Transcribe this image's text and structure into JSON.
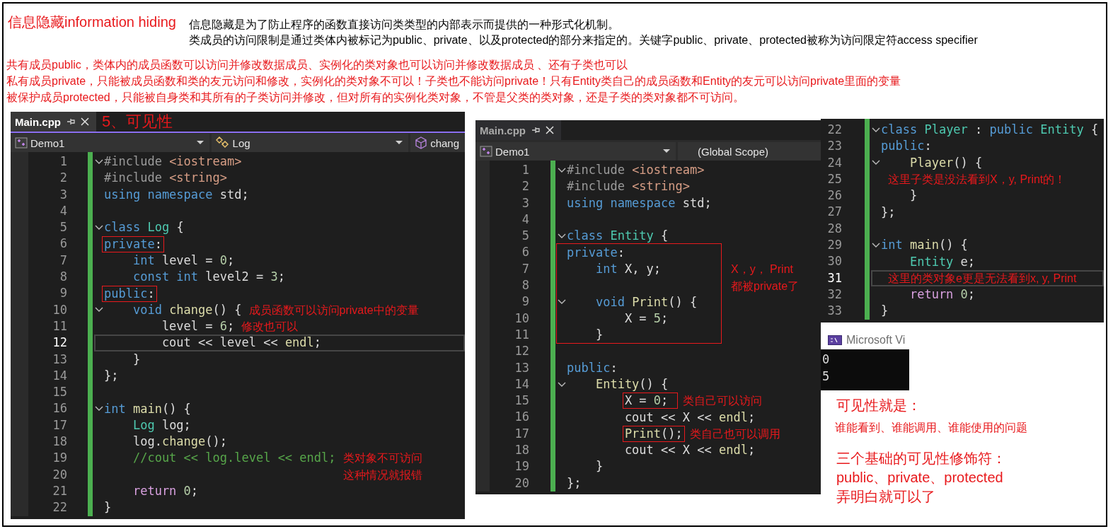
{
  "heading": {
    "title": "信息隐藏information hiding",
    "description": [
      "信息隐藏是为了防止程序的函数直接访问类类型的内部表示而提供的一种形式化机制。",
      "类成员的访问限制是通过类体内被标记为public、private、以及protected的部分来指定的。关键字public、private、protected被称为访问限定符access specifier"
    ]
  },
  "notes": [
    "共有成员public，类体内的成员函数可以访问并修改数据成员、实例化的类对象也可以访问并修改数据成员 、还有子类也可以",
    "私有成员private，只能被成员函数和类的友元访问和修改，实例化的类对象不可以！子类也不能访问private！只有Entity类自己的成员函数和Entity的友元可以访问private里面的变量",
    "被保护成员protected，只能被自身类和其所有的子类访问并修改，但对所有的实例化类对象，不管是父类的类对象，还是子类的类对象都不可访问。"
  ],
  "editors": [
    {
      "tab": {
        "label": "Main.cpp",
        "selected": true
      },
      "caption": "5、可见性",
      "nav": [
        {
          "kind": "project",
          "label": "Demo1",
          "caret": true
        },
        {
          "kind": "class",
          "label": "Log",
          "caret": true
        },
        {
          "kind": "method",
          "label": "chang",
          "caret": false
        }
      ],
      "lines": [
        {
          "kind": "line",
          "number": "1",
          "fold": true,
          "tokens": [
            {
              "kind": "pp",
              "text": "#include "
            },
            {
              "kind": "str",
              "text": "<iostream>"
            }
          ]
        },
        {
          "kind": "line",
          "number": "2",
          "tokens": [
            {
              "kind": "pp",
              "text": "#include "
            },
            {
              "kind": "str",
              "text": "<string>"
            }
          ]
        },
        {
          "kind": "line",
          "number": "3",
          "tokens": [
            {
              "kind": "kw",
              "text": "using namespace"
            },
            {
              "kind": "p",
              "text": " std;"
            }
          ]
        },
        {
          "kind": "line",
          "number": "4"
        },
        {
          "kind": "line",
          "number": "5",
          "fold": true,
          "tokens": [
            {
              "kind": "kw",
              "text": "class "
            },
            {
              "kind": "type",
              "text": "Log"
            },
            {
              "kind": "p",
              "text": " {"
            }
          ]
        },
        {
          "kind": "line",
          "number": "6",
          "tokens": [
            {
              "kind": "kw",
              "text": "private",
              "boxed": true
            },
            {
              "kind": "p",
              "text": ":",
              "boxed": true
            }
          ]
        },
        {
          "kind": "line",
          "number": "7",
          "tokens": [
            {
              "kind": "kw",
              "text": "    int"
            },
            {
              "kind": "p",
              "text": " level = "
            },
            {
              "kind": "num",
              "text": "0"
            },
            {
              "kind": "p",
              "text": ";"
            }
          ]
        },
        {
          "kind": "line",
          "number": "8",
          "tokens": [
            {
              "kind": "kw",
              "text": "    const int"
            },
            {
              "kind": "p",
              "text": " level2 = "
            },
            {
              "kind": "num",
              "text": "3"
            },
            {
              "kind": "p",
              "text": ";"
            }
          ]
        },
        {
          "kind": "line",
          "number": "9",
          "tokens": [
            {
              "kind": "kw",
              "text": "public",
              "boxed": true
            },
            {
              "kind": "p",
              "text": ":",
              "boxed": true
            }
          ]
        },
        {
          "kind": "line",
          "number": "10",
          "fold": true,
          "tokens": [
            {
              "kind": "kw",
              "text": "    void "
            },
            {
              "kind": "fn",
              "text": "change"
            },
            {
              "kind": "p",
              "text": "() {"
            }
          ],
          "note": [
            "成员函数可以访问private中的变量"
          ]
        },
        {
          "kind": "line",
          "number": "11",
          "tokens": [
            {
              "kind": "p",
              "text": "        level = "
            },
            {
              "kind": "num",
              "text": "6"
            },
            {
              "kind": "p",
              "text": ";"
            }
          ],
          "note": [
            "修改也可以"
          ]
        },
        {
          "kind": "line",
          "number": "12",
          "current": true,
          "tokens": [
            {
              "kind": "p",
              "text": "        cout << level << "
            },
            {
              "kind": "fn",
              "text": "endl"
            },
            {
              "kind": "p",
              "text": ";"
            }
          ]
        },
        {
          "kind": "line",
          "number": "13",
          "tokens": [
            {
              "kind": "p",
              "text": "    }"
            }
          ]
        },
        {
          "kind": "line",
          "number": "14",
          "tokens": [
            {
              "kind": "p",
              "text": "};"
            }
          ]
        },
        {
          "kind": "line",
          "number": "15"
        },
        {
          "kind": "line",
          "number": "16",
          "fold": true,
          "tokens": [
            {
              "kind": "kw",
              "text": "int "
            },
            {
              "kind": "fn",
              "text": "main"
            },
            {
              "kind": "p",
              "text": "() {"
            }
          ]
        },
        {
          "kind": "line",
          "number": "17",
          "tokens": [
            {
              "kind": "type",
              "text": "    Log"
            },
            {
              "kind": "p",
              "text": " log;"
            }
          ]
        },
        {
          "kind": "line",
          "number": "18",
          "tokens": [
            {
              "kind": "p",
              "text": "    log."
            },
            {
              "kind": "fn",
              "text": "change"
            },
            {
              "kind": "p",
              "text": "();"
            }
          ]
        },
        {
          "kind": "line",
          "number": "19",
          "tokens": [
            {
              "kind": "cmt",
              "text": "    //cout << log.level << endl;"
            }
          ],
          "note": [
            "类对象不可访问",
            "这种情况就报错"
          ]
        },
        {
          "kind": "line",
          "number": "20"
        },
        {
          "kind": "line",
          "number": "21",
          "tokens": [
            {
              "kind": "ctl",
              "text": "    return "
            },
            {
              "kind": "num",
              "text": "0"
            },
            {
              "kind": "p",
              "text": ";"
            }
          ]
        },
        {
          "kind": "line",
          "number": "22",
          "tokens": [
            {
              "kind": "p",
              "text": "}"
            }
          ]
        }
      ]
    },
    {
      "tab": {
        "label": "Main.cpp",
        "selected": false
      },
      "nav": [
        {
          "kind": "project",
          "label": "Demo1",
          "caret": true
        },
        {
          "kind": "scope",
          "label": "(Global Scope)",
          "caret": false
        }
      ],
      "lines": [
        {
          "kind": "line",
          "number": "1",
          "fold": true,
          "tokens": [
            {
              "kind": "pp",
              "text": "#include "
            },
            {
              "kind": "str",
              "text": "<iostream>"
            }
          ]
        },
        {
          "kind": "line",
          "number": "2",
          "tokens": [
            {
              "kind": "pp",
              "text": "#include "
            },
            {
              "kind": "str",
              "text": "<string>"
            }
          ]
        },
        {
          "kind": "line",
          "number": "3",
          "tokens": [
            {
              "kind": "kw",
              "text": "using namespace"
            },
            {
              "kind": "p",
              "text": " std;"
            }
          ]
        },
        {
          "kind": "line",
          "number": "4"
        },
        {
          "kind": "line",
          "number": "5",
          "fold": true,
          "tokens": [
            {
              "kind": "kw",
              "text": "class "
            },
            {
              "kind": "type",
              "text": "Entity"
            },
            {
              "kind": "p",
              "text": " {"
            }
          ]
        },
        {
          "kind": "annotation_box",
          "lines": [
            {
              "kind": "line",
              "number": "6",
              "tokens": [
                {
                  "kind": "kw",
                  "text": "private"
                },
                {
                  "kind": "p",
                  "text": ":"
                }
              ]
            },
            {
              "kind": "line",
              "number": "7",
              "tokens": [
                {
                  "kind": "kw",
                  "text": "    int"
                },
                {
                  "kind": "p",
                  "text": " X, y;"
                }
              ],
              "note": [
                "X，y， Print",
                "都被private了"
              ]
            },
            {
              "kind": "line",
              "number": "8"
            },
            {
              "kind": "line",
              "number": "9",
              "fold": true,
              "tokens": [
                {
                  "kind": "kw",
                  "text": "    void "
                },
                {
                  "kind": "fn",
                  "text": "Print"
                },
                {
                  "kind": "p",
                  "text": "() {"
                }
              ]
            },
            {
              "kind": "line",
              "number": "10",
              "tokens": [
                {
                  "kind": "p",
                  "text": "        X = "
                },
                {
                  "kind": "num",
                  "text": "5"
                },
                {
                  "kind": "p",
                  "text": ";"
                }
              ]
            },
            {
              "kind": "line",
              "number": "11",
              "tokens": [
                {
                  "kind": "p",
                  "text": "    }"
                }
              ]
            }
          ]
        },
        {
          "kind": "line",
          "number": "12"
        },
        {
          "kind": "line",
          "number": "13",
          "tokens": [
            {
              "kind": "kw",
              "text": "public"
            },
            {
              "kind": "p",
              "text": ":"
            }
          ]
        },
        {
          "kind": "line",
          "number": "14",
          "fold": true,
          "tokens": [
            {
              "kind": "fn",
              "text": "    Entity"
            },
            {
              "kind": "p",
              "text": "() {"
            }
          ]
        },
        {
          "kind": "line",
          "number": "15",
          "tokens": [
            {
              "kind": "p",
              "text": "X = ",
              "boxed": true
            },
            {
              "kind": "num",
              "text": "0",
              "boxed": true
            },
            {
              "kind": "p",
              "text": "; ",
              "boxed": true
            }
          ],
          "indented": true,
          "note": [
            "类自己可以访问"
          ]
        },
        {
          "kind": "line",
          "number": "16",
          "tokens": [
            {
              "kind": "p",
              "text": "        cout << X << "
            },
            {
              "kind": "fn",
              "text": "endl"
            },
            {
              "kind": "p",
              "text": ";"
            }
          ]
        },
        {
          "kind": "line",
          "number": "17",
          "tokens": [
            {
              "kind": "fn",
              "text": "Print",
              "boxed": true
            },
            {
              "kind": "p",
              "text": "();",
              "boxed": true
            }
          ],
          "indented": true,
          "note": [
            "类自己也可以调用"
          ]
        },
        {
          "kind": "line",
          "number": "18",
          "tokens": [
            {
              "kind": "p",
              "text": "        cout << X << "
            },
            {
              "kind": "fn",
              "text": "endl"
            },
            {
              "kind": "p",
              "text": ";"
            }
          ]
        },
        {
          "kind": "line",
          "number": "19",
          "tokens": [
            {
              "kind": "p",
              "text": "    }"
            }
          ]
        },
        {
          "kind": "line",
          "number": "20",
          "tokens": [
            {
              "kind": "p",
              "text": "};"
            }
          ]
        }
      ]
    },
    {
      "lines": [
        {
          "kind": "line",
          "number": "22",
          "fold": true,
          "tokens": [
            {
              "kind": "kw",
              "text": "class "
            },
            {
              "kind": "type",
              "text": "Player"
            },
            {
              "kind": "p",
              "text": " : "
            },
            {
              "kind": "kw",
              "text": "public "
            },
            {
              "kind": "type",
              "text": "Entity"
            },
            {
              "kind": "p",
              "text": " {"
            }
          ]
        },
        {
          "kind": "line",
          "number": "23",
          "tokens": [
            {
              "kind": "kw",
              "text": "public"
            },
            {
              "kind": "p",
              "text": ":"
            }
          ]
        },
        {
          "kind": "line",
          "number": "24",
          "fold": true,
          "tokens": [
            {
              "kind": "fn",
              "text": "    Player"
            },
            {
              "kind": "p",
              "text": "() {"
            }
          ]
        },
        {
          "kind": "line",
          "number": "25",
          "note": [
            "这里子类是没法看到X，y, Print的！"
          ]
        },
        {
          "kind": "line",
          "number": "26",
          "tokens": [
            {
              "kind": "p",
              "text": "    }"
            }
          ]
        },
        {
          "kind": "line",
          "number": "27",
          "tokens": [
            {
              "kind": "p",
              "text": "};"
            }
          ]
        },
        {
          "kind": "line",
          "number": "28"
        },
        {
          "kind": "line",
          "number": "29",
          "fold": true,
          "tokens": [
            {
              "kind": "kw",
              "text": "int "
            },
            {
              "kind": "fn",
              "text": "main"
            },
            {
              "kind": "p",
              "text": "() {"
            }
          ]
        },
        {
          "kind": "line",
          "number": "30",
          "tokens": [
            {
              "kind": "type",
              "text": "    Entity"
            },
            {
              "kind": "p",
              "text": " e;"
            }
          ]
        },
        {
          "kind": "line",
          "number": "31",
          "current": true,
          "note": [
            "这里的类对象e更是无法看到x, y, Print"
          ]
        },
        {
          "kind": "line",
          "number": "32",
          "tokens": [
            {
              "kind": "ctl",
              "text": "    return "
            },
            {
              "kind": "num",
              "text": "0"
            },
            {
              "kind": "p",
              "text": ";"
            }
          ]
        },
        {
          "kind": "line",
          "number": "33",
          "tokens": [
            {
              "kind": "p",
              "text": "}"
            }
          ]
        }
      ]
    }
  ],
  "console": {
    "title": "Microsoft Vi",
    "output": [
      "0",
      "5"
    ]
  },
  "summary": [
    {
      "kind": "heading",
      "text": "可见性就是："
    },
    {
      "kind": "body",
      "text": "谁能看到、谁能调用、谁能使用的问题"
    },
    {
      "kind": "heading",
      "text": "三个基础的可见性修饰符："
    },
    {
      "kind": "heading",
      "text": "public、private、protected"
    },
    {
      "kind": "heading",
      "text": "弄明白就可以了"
    }
  ]
}
